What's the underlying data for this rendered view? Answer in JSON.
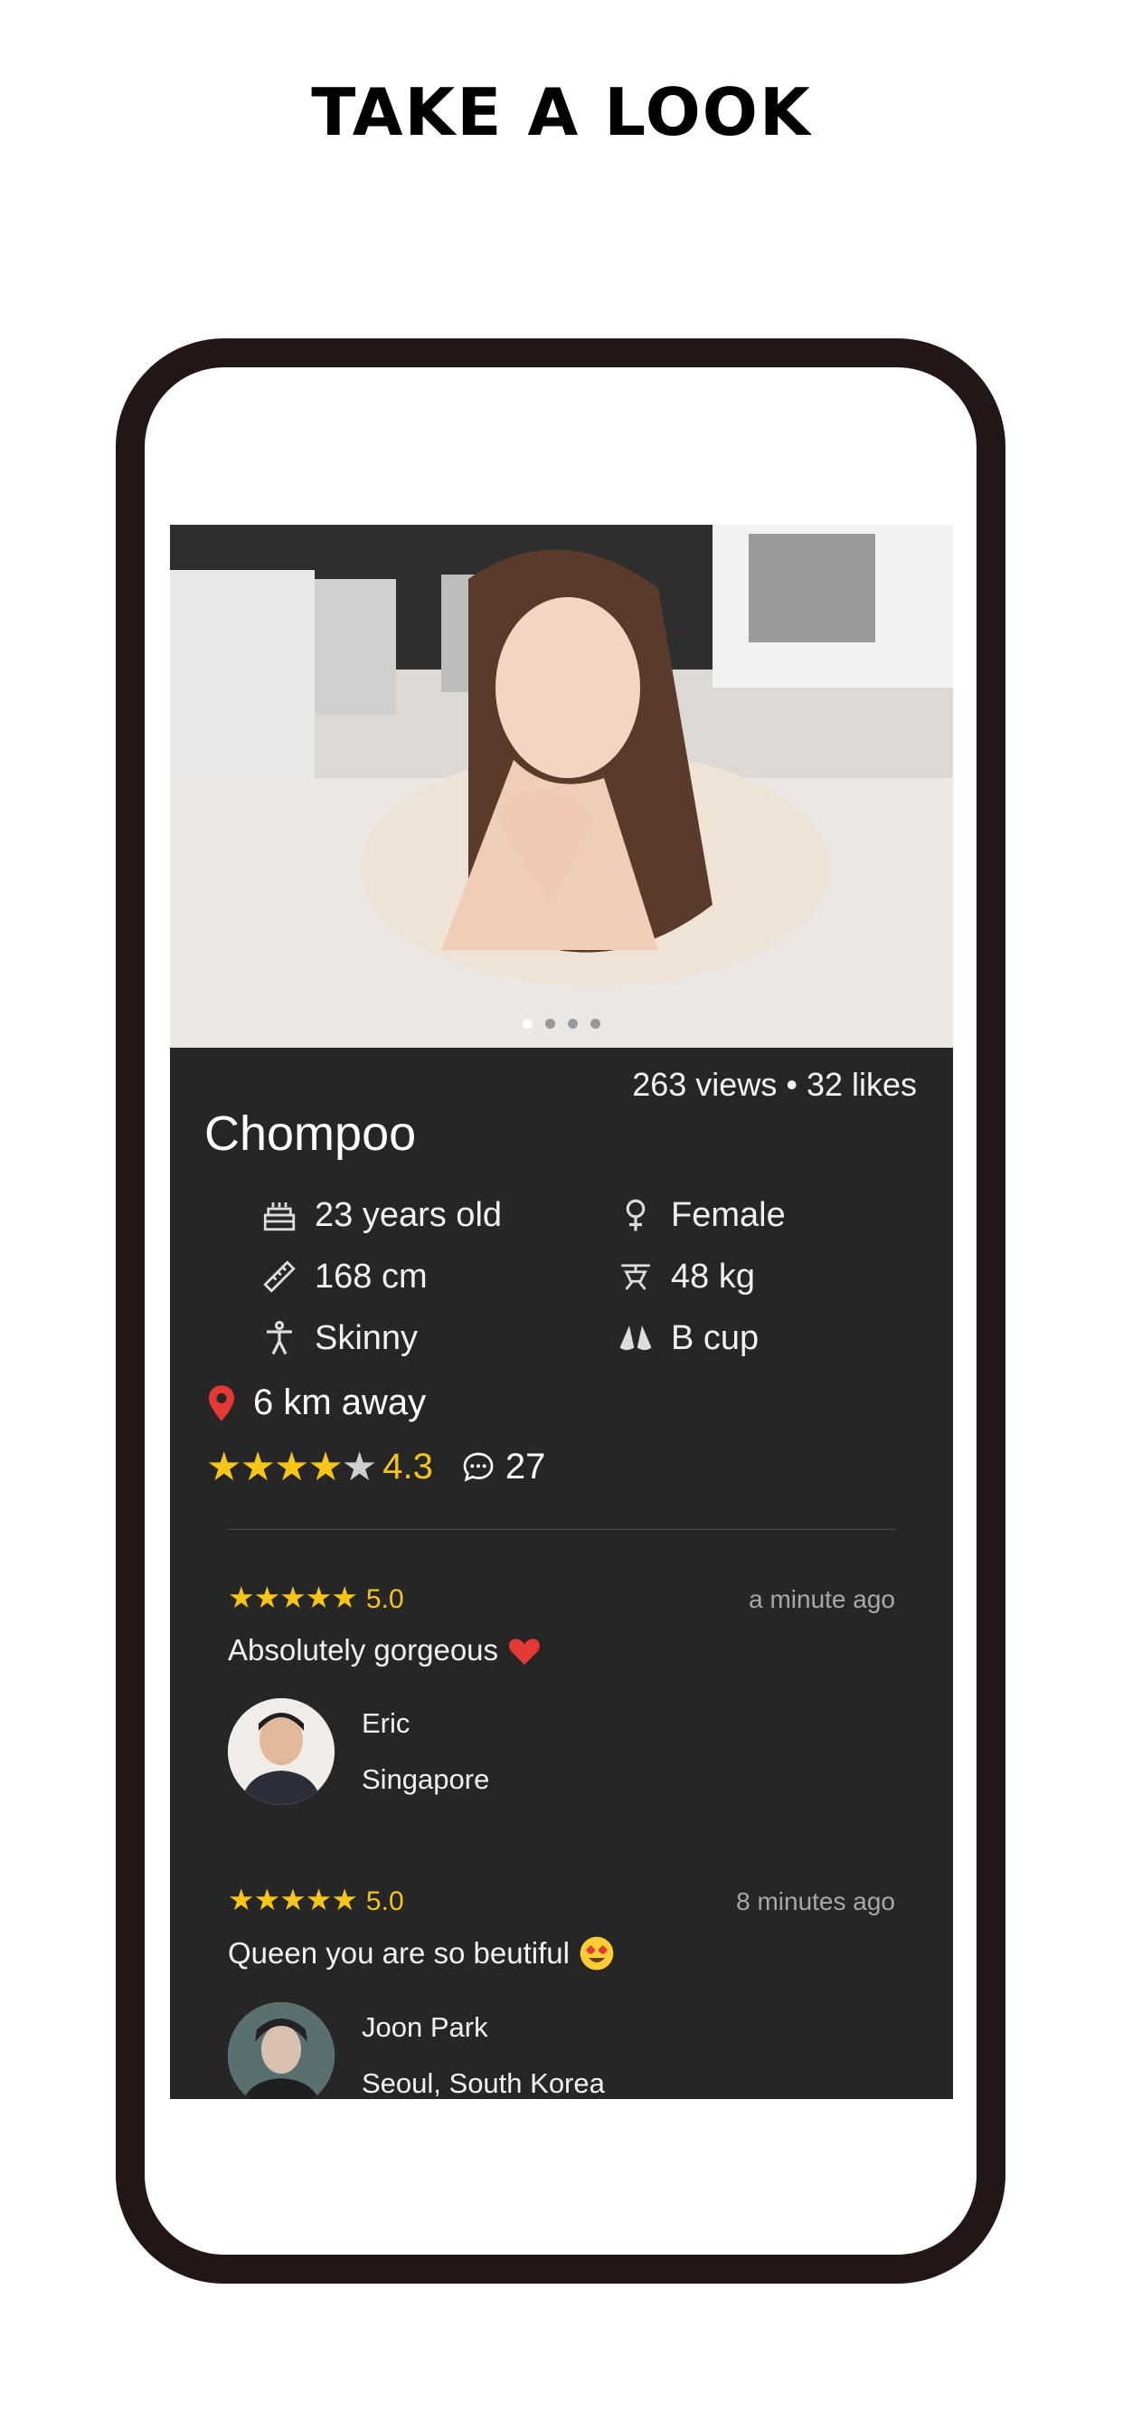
{
  "headline": "TAKE A LOOK",
  "profile": {
    "views": "263 views",
    "separator": "•",
    "likes": "32 likes",
    "name": "Chompoo",
    "photo_pages": 4,
    "photo_active_index": 0,
    "attributes": {
      "age": "23 years old",
      "gender": "Female",
      "height": "168 cm",
      "weight": "48 kg",
      "body": "Skinny",
      "cup": "B cup"
    },
    "distance": "6 km away",
    "rating_stars": 4,
    "rating": "4.3",
    "comments": "27"
  },
  "reviews": [
    {
      "stars": 5,
      "score": "5.0",
      "time": "a minute ago",
      "text": "Absolutely gorgeous",
      "emoji": "red-heart-icon",
      "user": "Eric",
      "location": "Singapore"
    },
    {
      "stars": 5,
      "score": "5.0",
      "time": "8 minutes ago",
      "text": "Queen you are so beutiful",
      "emoji": "heart-eyes-emoji-icon",
      "user": "Joon Park",
      "location": "Seoul, South Korea"
    }
  ],
  "colors": {
    "frame": "#221616",
    "panel": "#262626",
    "star": "#f5c518",
    "pin": "#e53935"
  }
}
